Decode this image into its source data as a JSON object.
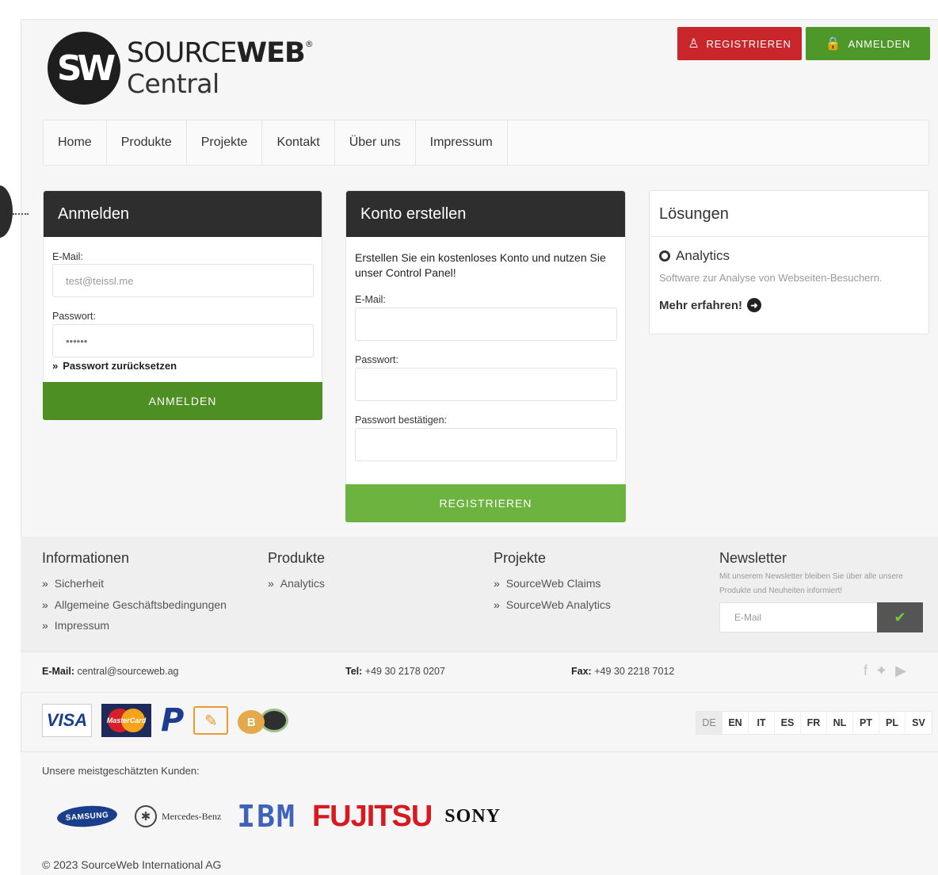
{
  "header": {
    "logo_initials": "SW",
    "logo_name_light": "SOURCE",
    "logo_name_bold": "WEB",
    "logo_reg": "®",
    "logo_sub": "Central",
    "register_label": "REGISTRIEREN",
    "login_label": "ANMELDEN"
  },
  "nav": [
    "Home",
    "Produkte",
    "Projekte",
    "Kontakt",
    "Über uns",
    "Impressum"
  ],
  "login": {
    "title": "Anmelden",
    "email_label": "E-Mail:",
    "email_value": "test@teissl.me",
    "password_label": "Passwort:",
    "password_value": "••••••",
    "reset_label": "Passwort zurücksetzen",
    "submit_label": "ANMELDEN"
  },
  "register": {
    "title": "Konto erstellen",
    "intro": "Erstellen Sie ein kostenloses Konto und nutzen Sie unser Control Panel!",
    "email_label": "E-Mail:",
    "password_label": "Passwort:",
    "confirm_label": "Passwort bestätigen:",
    "submit_label": "REGISTRIEREN"
  },
  "solutions": {
    "title": "Lösungen",
    "item_title": "Analytics",
    "item_desc": "Software zur Analyse von Webseiten-Besuchern.",
    "more_label": "Mehr erfahren!"
  },
  "footer": {
    "info_title": "Informationen",
    "info_links": [
      "Sicherheit",
      "Allgemeine Geschäftsbedingungen",
      "Impressum"
    ],
    "products_title": "Produkte",
    "products_links": [
      "Analytics"
    ],
    "projects_title": "Projekte",
    "projects_links": [
      "SourceWeb Claims",
      "SourceWeb Analytics"
    ],
    "newsletter_title": "Newsletter",
    "newsletter_text": "Mit unserem Newsletter bleiben Sie über alle unsere Produkte und Neuheiten informiert!",
    "newsletter_placeholder": "E-Mail"
  },
  "contact": {
    "email_label": "E-Mail:",
    "email_value": "central@sourceweb.ag",
    "tel_label": "Tel:",
    "tel_value": "+49 30 2178 0207",
    "fax_label": "Fax:",
    "fax_value": "+49 30 2218 7012"
  },
  "payments": {
    "visa": "VISA",
    "mastercard": "MasterCard",
    "paypal": "P",
    "bitcoin": "B"
  },
  "languages": [
    "DE",
    "EN",
    "IT",
    "ES",
    "FR",
    "NL",
    "PT",
    "PL",
    "SV"
  ],
  "clients": {
    "label": "Unsere meistgeschätzten Kunden:",
    "samsung": "SAMSUNG",
    "mercedes": "Mercedes-Benz",
    "ibm": "IBM",
    "fujitsu": "FUJITSU",
    "sony": "SONY"
  },
  "copyright": "© 2023 SourceWeb International AG",
  "colors": {
    "register_red": "#c8262a",
    "login_green": "#4e9729",
    "panel_dark": "#2e2e2e"
  }
}
